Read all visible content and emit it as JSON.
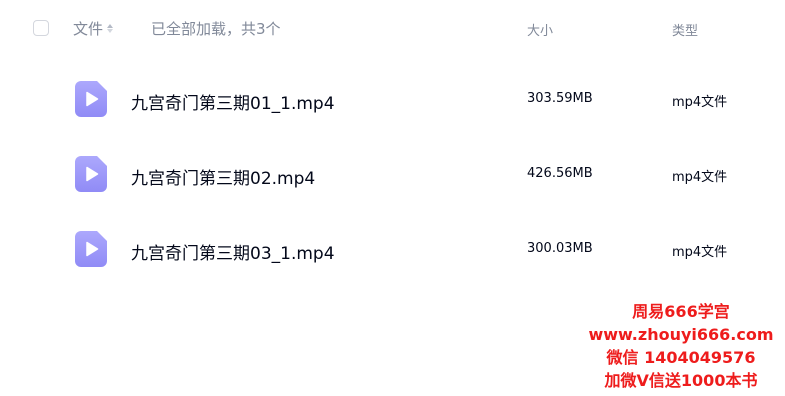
{
  "header": {
    "name_label": "文件",
    "load_status": "已全部加载，共3个",
    "size_label": "大小",
    "type_label": "类型"
  },
  "files": [
    {
      "name": "九宫奇门第三期01_1.mp4",
      "size": "303.59MB",
      "type": "mp4文件"
    },
    {
      "name": "九宫奇门第三期02.mp4",
      "size": "426.56MB",
      "type": "mp4文件"
    },
    {
      "name": "九宫奇门第三期03_1.mp4",
      "size": "300.03MB",
      "type": "mp4文件"
    }
  ],
  "watermark": {
    "line1": "周易666学宫",
    "line2": "www.zhouyi666.com",
    "line3": "微信 1404049576",
    "line4": "加微V信送1000本书"
  },
  "colors": {
    "file_icon": "#a5a1fb",
    "file_icon_gradient_end": "#8f8af5",
    "watermark": "#ee1c1c",
    "header_text": "#818999",
    "body_text": "#03081a"
  },
  "icons": {
    "file": "video-file-icon",
    "sort": "sort-icon"
  }
}
